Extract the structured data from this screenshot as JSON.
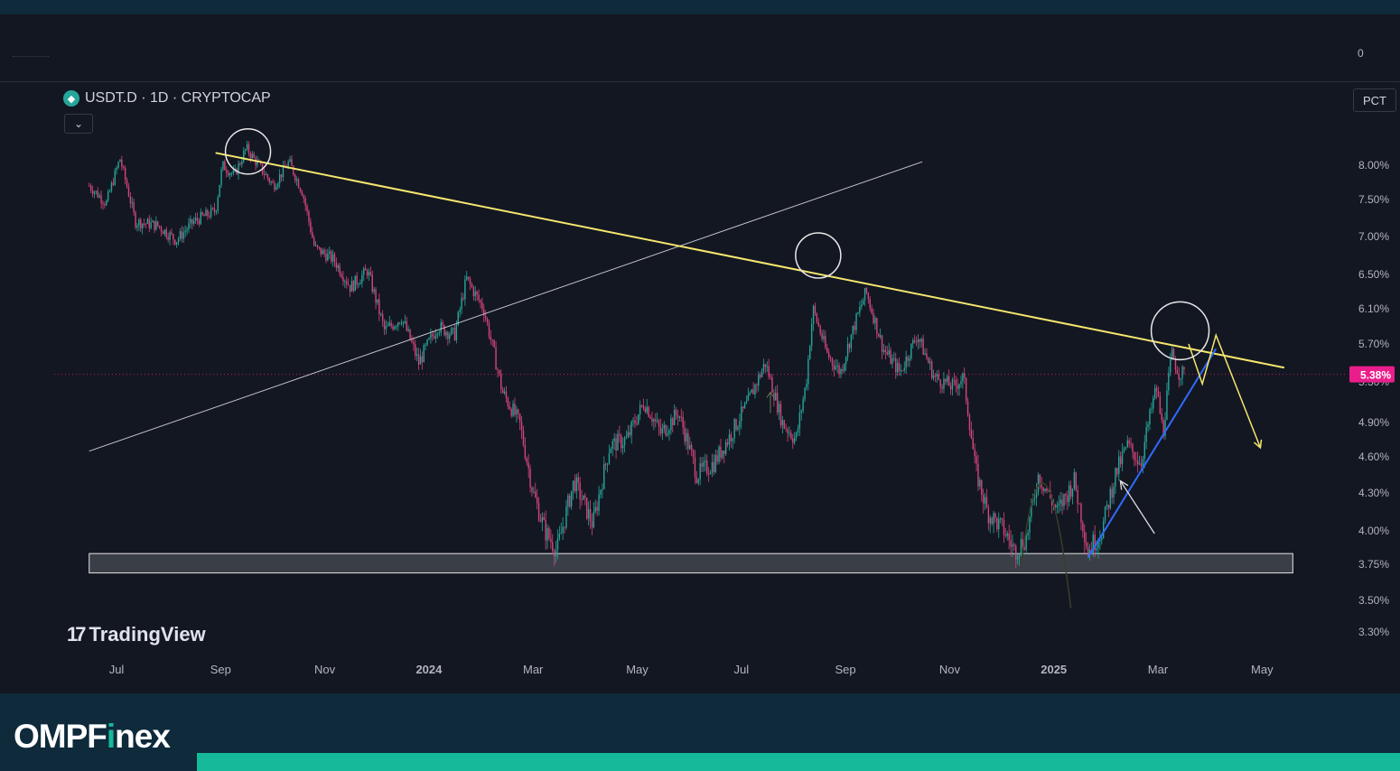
{
  "header": {
    "zero_label": "0"
  },
  "symbol": {
    "icon": "tether-diamond-icon",
    "text": "USDT.D · 1D · CRYPTOCAP"
  },
  "controls": {
    "collapse_icon": "chevron-down-icon",
    "pct_label": "PCT"
  },
  "watermark": {
    "text": "TradingView"
  },
  "footer": {
    "brand_prefix": "OMPF",
    "brand_i": "i",
    "brand_suffix": "nex"
  },
  "chart_data": {
    "type": "candlestick",
    "title": "USDT.D · 1D · CRYPTOCAP",
    "price_scale": "PCT",
    "y_ticks": [
      "8.00%",
      "7.50%",
      "7.00%",
      "6.50%",
      "6.10%",
      "5.70%",
      "5.30%",
      "4.90%",
      "4.60%",
      "4.30%",
      "4.00%",
      "3.75%",
      "3.50%",
      "3.30%"
    ],
    "x_ticks": [
      {
        "label": "Jul",
        "bold": false
      },
      {
        "label": "Sep",
        "bold": false
      },
      {
        "label": "Nov",
        "bold": false
      },
      {
        "label": "2024",
        "bold": true
      },
      {
        "label": "Mar",
        "bold": false
      },
      {
        "label": "May",
        "bold": false
      },
      {
        "label": "Jul",
        "bold": false
      },
      {
        "label": "Sep",
        "bold": false
      },
      {
        "label": "Nov",
        "bold": false
      },
      {
        "label": "2025",
        "bold": true
      },
      {
        "label": "Mar",
        "bold": false
      },
      {
        "label": "May",
        "bold": false
      }
    ],
    "ylim": [
      3.3,
      8.0
    ],
    "last_price_label": "5.38%",
    "last_price_value": 5.38,
    "price_path": [
      [
        "2023-06-15",
        7.7
      ],
      [
        "2023-06-25",
        7.45
      ],
      [
        "2023-07-03",
        8.1
      ],
      [
        "2023-07-12",
        7.2
      ],
      [
        "2023-07-25",
        7.15
      ],
      [
        "2023-08-05",
        6.95
      ],
      [
        "2023-08-15",
        7.2
      ],
      [
        "2023-08-28",
        7.35
      ],
      [
        "2023-09-01",
        8.0
      ],
      [
        "2023-09-08",
        7.85
      ],
      [
        "2023-09-15",
        8.25
      ],
      [
        "2023-09-25",
        7.9
      ],
      [
        "2023-10-01",
        7.7
      ],
      [
        "2023-10-10",
        8.05
      ],
      [
        "2023-10-18",
        7.6
      ],
      [
        "2023-10-25",
        6.85
      ],
      [
        "2023-11-05",
        6.7
      ],
      [
        "2023-11-15",
        6.35
      ],
      [
        "2023-11-25",
        6.55
      ],
      [
        "2023-12-05",
        5.85
      ],
      [
        "2023-12-15",
        6.0
      ],
      [
        "2023-12-25",
        5.5
      ],
      [
        "2024-01-05",
        5.9
      ],
      [
        "2024-01-15",
        5.8
      ],
      [
        "2024-01-22",
        6.45
      ],
      [
        "2024-02-01",
        6.1
      ],
      [
        "2024-02-12",
        5.2
      ],
      [
        "2024-02-22",
        4.9
      ],
      [
        "2024-03-01",
        4.3
      ],
      [
        "2024-03-08",
        4.0
      ],
      [
        "2024-03-15",
        3.85
      ],
      [
        "2024-03-25",
        4.4
      ],
      [
        "2024-04-05",
        4.05
      ],
      [
        "2024-04-15",
        4.7
      ],
      [
        "2024-04-25",
        4.75
      ],
      [
        "2024-05-05",
        5.1
      ],
      [
        "2024-05-15",
        4.8
      ],
      [
        "2024-05-25",
        5.0
      ],
      [
        "2024-06-05",
        4.45
      ],
      [
        "2024-06-15",
        4.55
      ],
      [
        "2024-06-25",
        4.8
      ],
      [
        "2024-07-05",
        5.1
      ],
      [
        "2024-07-15",
        5.5
      ],
      [
        "2024-07-25",
        4.9
      ],
      [
        "2024-08-02",
        4.75
      ],
      [
        "2024-08-08",
        5.3
      ],
      [
        "2024-08-12",
        6.1
      ],
      [
        "2024-08-20",
        5.6
      ],
      [
        "2024-08-28",
        5.4
      ],
      [
        "2024-09-05",
        5.9
      ],
      [
        "2024-09-12",
        6.3
      ],
      [
        "2024-09-22",
        5.65
      ],
      [
        "2024-10-02",
        5.4
      ],
      [
        "2024-10-12",
        5.8
      ],
      [
        "2024-10-22",
        5.35
      ],
      [
        "2024-11-02",
        5.25
      ],
      [
        "2024-11-08",
        5.35
      ],
      [
        "2024-11-15",
        4.5
      ],
      [
        "2024-11-22",
        4.15
      ],
      [
        "2024-12-02",
        4.0
      ],
      [
        "2024-12-08",
        3.85
      ],
      [
        "2024-12-15",
        3.95
      ],
      [
        "2024-12-22",
        4.45
      ],
      [
        "2025-01-02",
        4.15
      ],
      [
        "2025-01-12",
        4.4
      ],
      [
        "2025-01-20",
        3.85
      ],
      [
        "2025-01-28",
        4.0
      ],
      [
        "2025-02-05",
        4.45
      ],
      [
        "2025-02-12",
        4.7
      ],
      [
        "2025-02-20",
        4.55
      ],
      [
        "2025-03-01",
        5.25
      ],
      [
        "2025-03-05",
        4.8
      ],
      [
        "2025-03-10",
        5.6
      ],
      [
        "2025-03-14",
        5.4
      ],
      [
        "2025-03-18",
        5.38
      ]
    ],
    "drawings": {
      "descending_resistance": {
        "color": "#f5e66e",
        "from": [
          "2023-08-28",
          8.18
        ],
        "to": [
          "2025-05-15",
          5.45
        ]
      },
      "ascending_line": {
        "color": "#c8c8d0",
        "from": [
          "2023-06-15",
          4.65
        ],
        "to": [
          "2024-10-15",
          8.05
        ]
      },
      "support_zone": {
        "from": "2023-06-15",
        "to": "2025-05-20",
        "range": [
          3.69,
          3.83
        ]
      },
      "uptrend_line": {
        "color": "#2f6bff",
        "from": [
          "2025-01-20",
          3.8
        ],
        "to": [
          "2025-04-05",
          5.65
        ]
      },
      "projection_path": {
        "color": "#f5e66e",
        "points": [
          [
            "2025-03-20",
            5.7
          ],
          [
            "2025-03-28",
            5.28
          ],
          [
            "2025-04-05",
            5.8
          ],
          [
            "2025-05-01",
            4.68
          ]
        ]
      },
      "circles": [
        [
          "2023-09-16",
          8.2
        ],
        [
          "2024-08-15",
          6.75
        ],
        [
          "2025-03-15",
          5.85
        ]
      ],
      "pointer_arrow": {
        "color": "#e0e0e0",
        "from": [
          "2025-02-28",
          3.98
        ],
        "to": [
          "2025-02-08",
          4.4
        ]
      },
      "curve_arc": {
        "color": "#3a3f2a"
      },
      "small_up_arrow": {
        "color": "#6b7b5a",
        "at": [
          "2024-07-18",
          5.1
        ]
      }
    }
  }
}
